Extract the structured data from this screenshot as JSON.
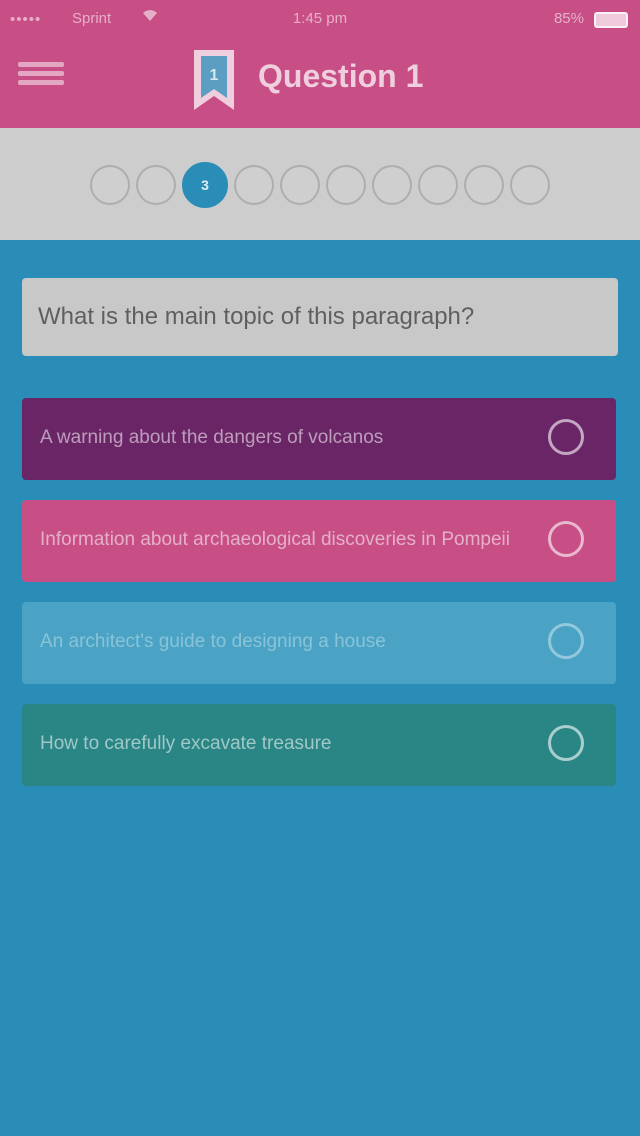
{
  "status_bar": {
    "signal": "•••••",
    "carrier": "Sprint",
    "time": "1:45 pm",
    "battery": "85%"
  },
  "header": {
    "title": "Question 1",
    "bookmark_label": "1"
  },
  "progress": {
    "dots": [
      "",
      "",
      "3",
      "",
      "",
      "",
      "",
      "",
      "",
      ""
    ],
    "active_index": 2
  },
  "question": {
    "text": "What is the main topic of this paragraph?"
  },
  "answers": [
    {
      "label": "A warning about the dangers of volcanos",
      "color": "#6a2566"
    },
    {
      "label": "Information about archaeological discoveries in Pompeii",
      "color": "#c74f86"
    },
    {
      "label": "An architect's guide to designing a house",
      "color": "#4aa3c4"
    },
    {
      "label": "How to carefully excavate treasure",
      "color": "#2a8585"
    }
  ],
  "colors": {
    "header": "#c74f86",
    "background": "#2a8db7",
    "progress_bar": "#cdcdcd"
  }
}
